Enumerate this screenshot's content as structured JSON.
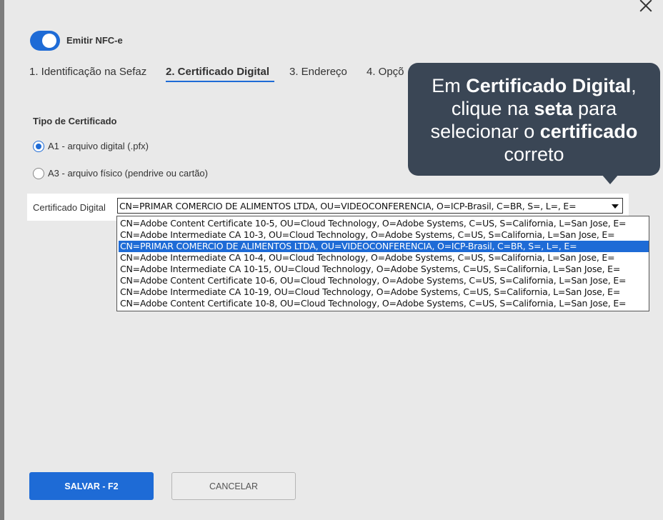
{
  "dialog": {
    "toggle": {
      "label": "Emitir NFC-e",
      "checked": true
    },
    "tabs": [
      {
        "label": "1. Identificação na Sefaz",
        "active": false
      },
      {
        "label": "2. Certificado Digital",
        "active": true
      },
      {
        "label": "3. Endereço",
        "active": false
      },
      {
        "label": "4. Opçõ",
        "active": false
      }
    ],
    "section_title": "Tipo de Certificado",
    "radios": [
      {
        "label": "A1 - arquivo digital (.pfx)",
        "checked": true
      },
      {
        "label": "A3 - arquivo físico (pendrive ou cartão)",
        "checked": false
      }
    ],
    "cert_label": "Certificado Digital",
    "cert_selected": "CN=PRIMAR COMERCIO DE ALIMENTOS LTDA, OU=VIDEOCONFERENCIA, O=ICP-Brasil, C=BR, S=, L=, E=",
    "options": [
      "CN=Adobe Content Certificate 10-5, OU=Cloud Technology, O=Adobe Systems, C=US, S=California, L=San Jose, E=",
      "CN=Adobe Intermediate CA 10-3, OU=Cloud Technology, O=Adobe Systems, C=US, S=California, L=San Jose, E=",
      "CN=PRIMAR COMERCIO DE ALIMENTOS LTDA, OU=VIDEOCONFERENCIA, O=ICP-Brasil, C=BR, S=, L=, E=",
      "CN=Adobe Intermediate CA 10-4, OU=Cloud Technology, O=Adobe Systems, C=US, S=California, L=San Jose, E=",
      "CN=Adobe Intermediate CA 10-15, OU=Cloud Technology, O=Adobe Systems, C=US, S=California, L=San Jose, E=",
      "CN=Adobe Content Certificate 10-6, OU=Cloud Technology, O=Adobe Systems, C=US, S=California, L=San Jose, E=",
      "CN=Adobe Intermediate CA 10-19, OU=Cloud Technology, O=Adobe Systems, C=US, S=California, L=San Jose, E=",
      "CN=Adobe Content Certificate 10-8, OU=Cloud Technology, O=Adobe Systems, C=US, S=California, L=San Jose, E="
    ],
    "selected_option_index": 2,
    "save_label": "SALVAR - F2",
    "cancel_label": "CANCELAR"
  },
  "tooltip": {
    "line1_pre": "Em ",
    "line1_bold": "Certificado Digital",
    "line1_post": ",",
    "line2_pre": "clique na ",
    "line2_bold": "seta",
    "line2_post": " para",
    "line3_pre": "selecionar o ",
    "line3_bold": "certificado",
    "line4": "correto"
  },
  "colors": {
    "accent": "#1e6bd6",
    "tooltip_bg": "#3a4655"
  }
}
